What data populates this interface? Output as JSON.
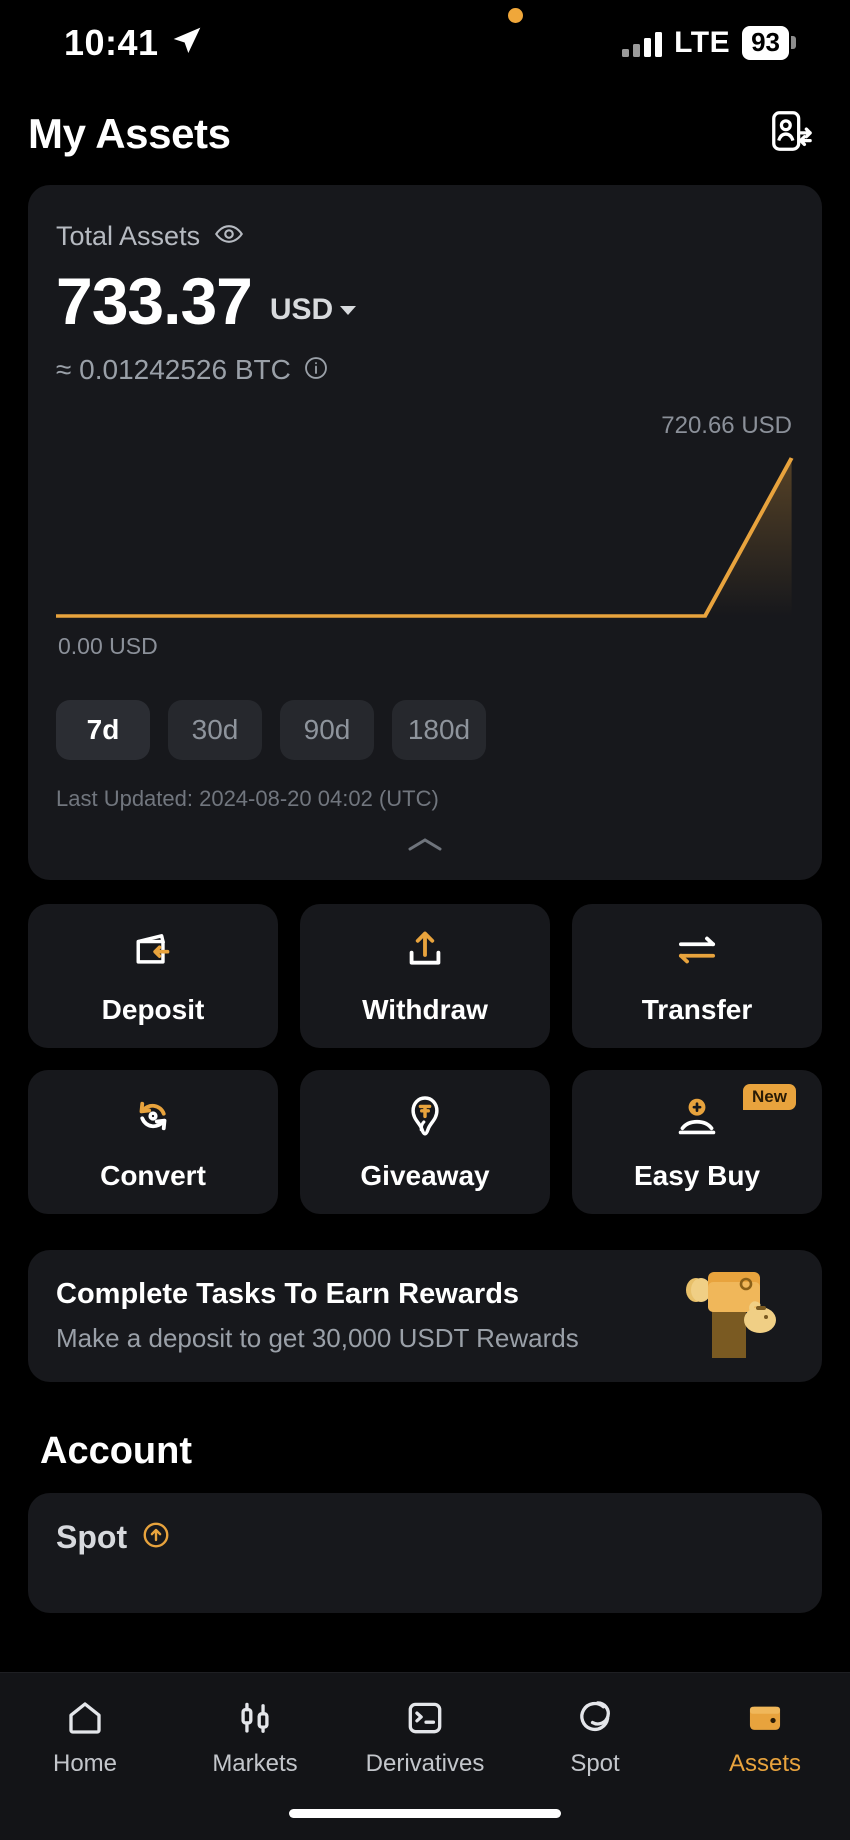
{
  "status_bar": {
    "time": "10:41",
    "location_icon": "location-arrow-icon",
    "network": "LTE",
    "battery": "93"
  },
  "header": {
    "title": "My Assets",
    "action_icon": "contact-transfer-icon"
  },
  "total_assets": {
    "label": "Total Assets",
    "eye_icon": "eye-icon",
    "amount": "733.37",
    "currency": "USD",
    "btc_equivalent": "≈ 0.01242526 BTC",
    "info_icon": "info-icon",
    "chart_high_label": "720.66 USD",
    "chart_low_label": "0.00 USD",
    "last_updated": "Last Updated: 2024-08-20 04:02 (UTC)",
    "collapse_icon": "chevron-up-icon",
    "ranges": [
      {
        "label": "7d",
        "active": true
      },
      {
        "label": "30d",
        "active": false
      },
      {
        "label": "90d",
        "active": false
      },
      {
        "label": "180d",
        "active": false
      }
    ]
  },
  "chart_data": {
    "type": "line",
    "title": "Total Assets 7d",
    "xlabel": "",
    "ylabel": "USD",
    "ylim": [
      0,
      720.66
    ],
    "y_axis_labels": [
      "720.66 USD",
      "0.00 USD"
    ],
    "grid": false,
    "legend": "none",
    "line_color": "#e8a33d",
    "fill": "gradient",
    "x": [
      0,
      1,
      2,
      3,
      4,
      5,
      6
    ],
    "values": [
      0,
      0,
      0,
      0,
      0,
      0,
      720.66
    ]
  },
  "actions": [
    {
      "label": "Deposit",
      "icon": "wallet-deposit-icon",
      "badge": ""
    },
    {
      "label": "Withdraw",
      "icon": "upload-arrow-icon",
      "badge": ""
    },
    {
      "label": "Transfer",
      "icon": "transfer-arrows-icon",
      "badge": ""
    },
    {
      "label": "Convert",
      "icon": "convert-refresh-icon",
      "badge": ""
    },
    {
      "label": "Giveaway",
      "icon": "giveaway-hand-icon",
      "badge": ""
    },
    {
      "label": "Easy Buy",
      "icon": "easy-buy-hand-coin-icon",
      "badge": "New"
    }
  ],
  "rewards_banner": {
    "title": "Complete Tasks To Earn Rewards",
    "subtitle": "Make a deposit to get 30,000 USDT Rewards",
    "illustration": "wallet-coins-piggy-icon"
  },
  "account": {
    "section_title": "Account",
    "rows": [
      {
        "name": "Spot",
        "icon": "arrow-up-circle-icon"
      }
    ]
  },
  "bottom_nav": [
    {
      "label": "Home",
      "icon": "home-icon",
      "active": false
    },
    {
      "label": "Markets",
      "icon": "candlestick-icon",
      "active": false
    },
    {
      "label": "Derivatives",
      "icon": "list-doc-icon",
      "active": false
    },
    {
      "label": "Spot",
      "icon": "spot-circle-icon",
      "active": false
    },
    {
      "label": "Assets",
      "icon": "wallet-icon",
      "active": true
    }
  ],
  "colors": {
    "accent": "#e8a33d",
    "background": "#000000",
    "card": "#17181c",
    "muted_text": "#9aa0a8"
  }
}
